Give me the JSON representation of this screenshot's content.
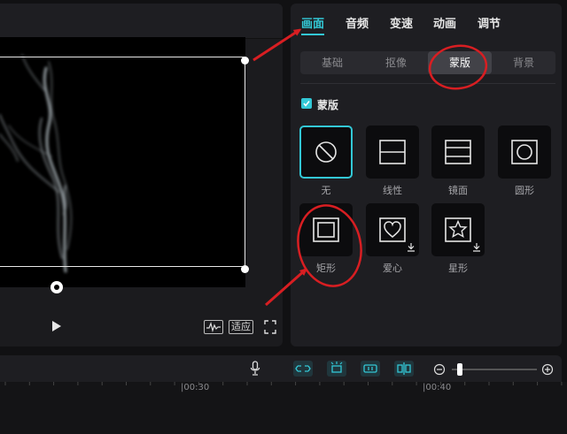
{
  "panel": {
    "tabs": [
      {
        "label": "画面",
        "active": true
      },
      {
        "label": "音频",
        "active": false
      },
      {
        "label": "变速",
        "active": false
      },
      {
        "label": "动画",
        "active": false
      },
      {
        "label": "调节",
        "active": false
      }
    ],
    "subtabs": [
      {
        "label": "基础",
        "active": false
      },
      {
        "label": "抠像",
        "active": false
      },
      {
        "label": "蒙版",
        "active": true
      },
      {
        "label": "背景",
        "active": false
      }
    ],
    "section_label": "蒙版",
    "section_checked": true,
    "masks": [
      {
        "label": "无",
        "icon": "no-mask-icon",
        "selected": true
      },
      {
        "label": "线性",
        "icon": "linear-mask-icon",
        "selected": false
      },
      {
        "label": "镜面",
        "icon": "mirror-mask-icon",
        "selected": false
      },
      {
        "label": "圆形",
        "icon": "circle-mask-icon",
        "selected": false
      },
      {
        "label": "矩形",
        "icon": "rectangle-mask-icon",
        "selected": false
      },
      {
        "label": "爱心",
        "icon": "heart-mask-icon",
        "selected": false,
        "downloadable": true
      },
      {
        "label": "星形",
        "icon": "star-mask-icon",
        "selected": false,
        "downloadable": true
      }
    ]
  },
  "player": {
    "fit_label": "适应",
    "icons": [
      "play-icon",
      "waveform-icon",
      "fullscreen-icon"
    ]
  },
  "timeline": {
    "tick_labels": [
      "|00:30",
      "|00:40"
    ]
  },
  "colors": {
    "accent": "#33c8d6",
    "annotation": "#d81e22",
    "panel_bg": "#1e1e22"
  }
}
